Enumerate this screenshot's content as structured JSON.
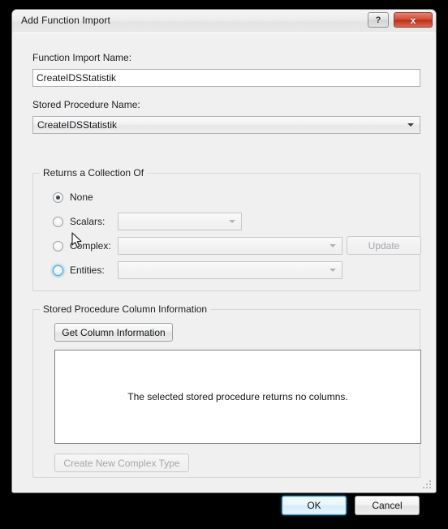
{
  "window": {
    "title": "Add Function Import",
    "help_button": "?",
    "close_button": "x"
  },
  "form": {
    "function_import_name_label": "Function Import Name:",
    "function_import_name_value": "CreateIDSStatistik",
    "function_import_name_placeholder": "",
    "stored_procedure_name_label": "Stored Procedure Name:",
    "stored_procedure_name_value": "CreateIDSStatistik"
  },
  "returns_group": {
    "title": "Returns a Collection Of",
    "options": [
      {
        "label": "None",
        "checked": true,
        "has_combo": false,
        "combo_value": ""
      },
      {
        "label": "Scalars:",
        "checked": false,
        "has_combo": true,
        "combo_value": ""
      },
      {
        "label": "Complex:",
        "checked": false,
        "has_combo": true,
        "combo_value": ""
      },
      {
        "label": "Entities:",
        "checked": false,
        "has_combo": true,
        "combo_value": ""
      }
    ],
    "update_button": "Update"
  },
  "column_info_group": {
    "title": "Stored Procedure Column Information",
    "get_column_information_button": "Get Column Information",
    "empty_message": "The selected stored procedure returns no columns.",
    "create_new_complex_type_button": "Create New Complex Type"
  },
  "footer": {
    "ok_button": "OK",
    "cancel_button": "Cancel"
  },
  "colors": {
    "accent": "#3a9bcb",
    "close_red": "#bb2f18",
    "dialog_bg": "#f0f0f0",
    "radio_dot": "#3c4a5a"
  }
}
